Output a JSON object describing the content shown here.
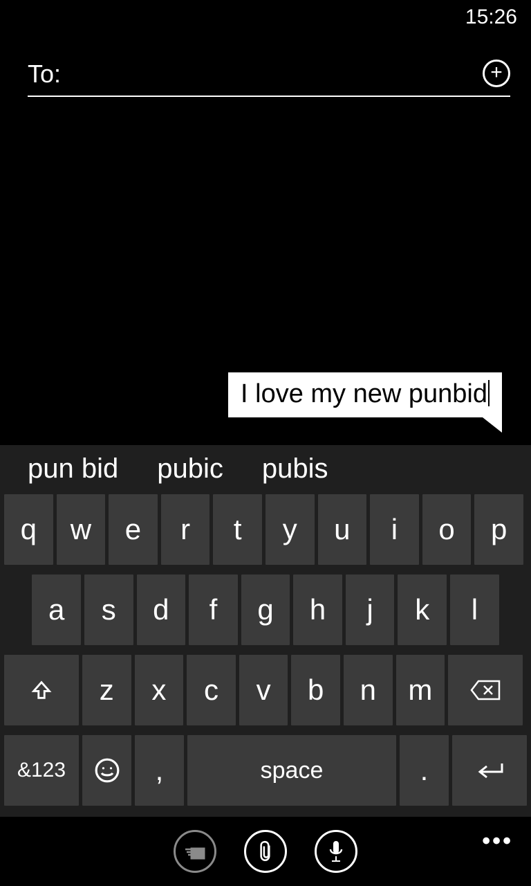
{
  "status": {
    "time": "15:26"
  },
  "compose": {
    "to_label": "To:",
    "to_value": "",
    "add_icon": "plus-icon"
  },
  "message": {
    "text": "I love my new punbid"
  },
  "suggestions": [
    "pun bid",
    "pubic",
    "pubis"
  ],
  "keyboard": {
    "row1": [
      "q",
      "w",
      "e",
      "r",
      "t",
      "y",
      "u",
      "i",
      "o",
      "p"
    ],
    "row2": [
      "a",
      "s",
      "d",
      "f",
      "g",
      "h",
      "j",
      "k",
      "l"
    ],
    "row3": [
      "z",
      "x",
      "c",
      "v",
      "b",
      "n",
      "m"
    ],
    "shift_icon": "arrow-up-icon",
    "backspace_icon": "backspace-icon",
    "symnum_label": "&123",
    "emoji_icon": "smile-icon",
    "comma": ",",
    "space_label": "space",
    "period": ".",
    "enter_icon": "return-icon"
  },
  "appbar": {
    "send_icon": "send-icon",
    "attach_icon": "paperclip-icon",
    "voice_icon": "microphone-icon",
    "more": "•••"
  }
}
